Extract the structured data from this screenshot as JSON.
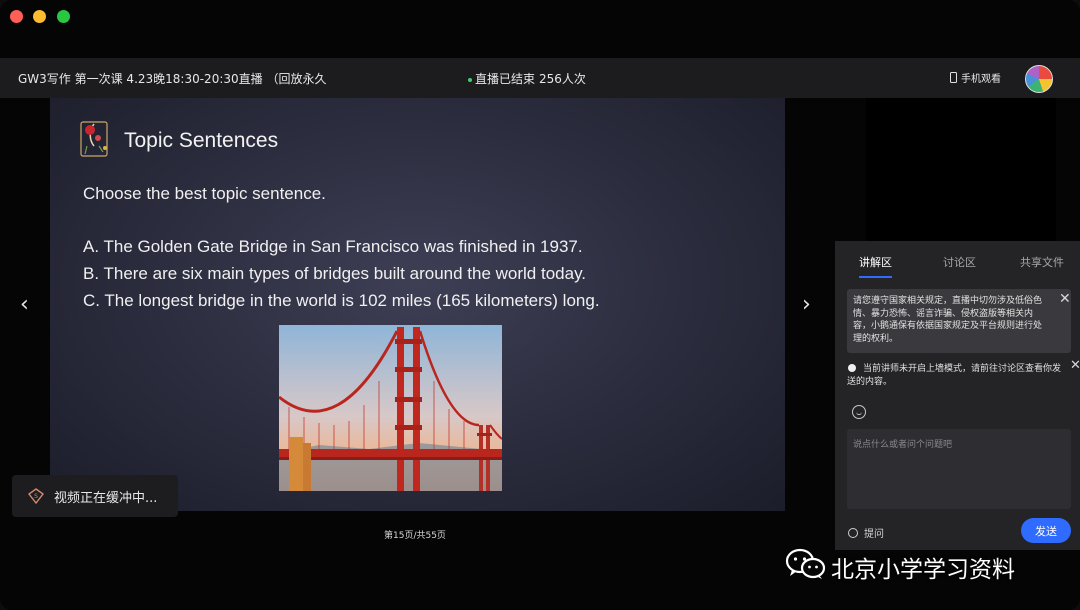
{
  "header": {
    "course_title": "GW3写作 第一次课 4.23晚18:30-20:30直播 （回放永久",
    "live_status": "直播已结束",
    "viewer_count": "256人次",
    "phone_watch": "手机观看"
  },
  "slide": {
    "title": "Topic Sentences",
    "prompt": "Choose the best topic sentence.",
    "options": [
      "A. The Golden Gate Bridge in San Francisco was finished in 1937.",
      "B. There are six main types of bridges built around the world today.",
      "C. The longest bridge in the world is 102 miles (165 kilometers) long."
    ]
  },
  "player": {
    "prev_arrow": "‹",
    "next_arrow": "›",
    "page_indicator": "第15页/共55页",
    "buffering_text": "视频正在缓冲中..."
  },
  "side_panel": {
    "tabs": [
      {
        "label": "讲解区",
        "active": true
      },
      {
        "label": "讨论区",
        "active": false
      },
      {
        "label": "共享文件",
        "active": false
      }
    ],
    "notice_text": "请您遵守国家相关规定，直播中切勿涉及低俗色情、暴力恐怖、谣言诈骗、侵权盗版等相关内容，小鹅通保有依据国家规定及平台规则进行处理的权利。",
    "hint_text": "当前讲师未开启上墙模式，请前往讨论区查看你发送的内容。",
    "close_glyph": "✕",
    "input_placeholder": "说点什么或者问个问题吧",
    "ask_label": "提问",
    "send_label": "发送"
  },
  "watermark": {
    "text": "北京小学学习资料"
  },
  "colors": {
    "accent": "#2f6bff",
    "live_dot": "#3ccf6c",
    "slide_bg": "#2a2b3c"
  }
}
